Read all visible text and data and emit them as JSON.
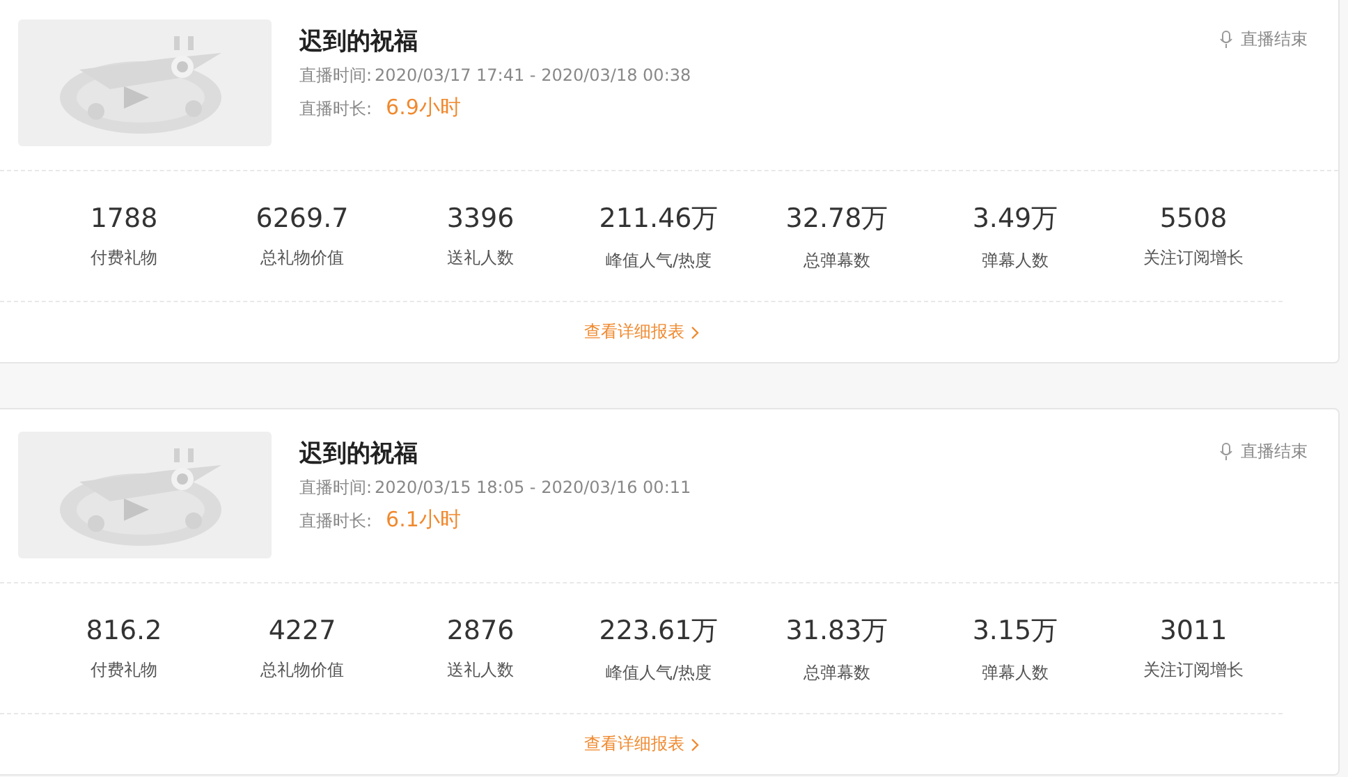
{
  "sessions": [
    {
      "title": "迟到的祝福",
      "time_label": "直播时间:",
      "time_range": "2020/03/17 17:41 - 2020/03/18 00:38",
      "duration_label": "直播时长:",
      "duration": "6.9小时",
      "status": "直播结束",
      "stats": [
        {
          "value": "1788",
          "label": "付费礼物"
        },
        {
          "value": "6269.7",
          "label": "总礼物价值"
        },
        {
          "value": "3396",
          "label": "送礼人数"
        },
        {
          "value": "211.46万",
          "label": "峰值人气/热度"
        },
        {
          "value": "32.78万",
          "label": "总弹幕数"
        },
        {
          "value": "3.49万",
          "label": "弹幕人数"
        },
        {
          "value": "5508",
          "label": "关注订阅增长"
        }
      ],
      "link": "查看详细报表"
    },
    {
      "title": "迟到的祝福",
      "time_label": "直播时间:",
      "time_range": "2020/03/15 18:05 - 2020/03/16 00:11",
      "duration_label": "直播时长:",
      "duration": "6.1小时",
      "status": "直播结束",
      "stats": [
        {
          "value": "816.2",
          "label": "付费礼物"
        },
        {
          "value": "4227",
          "label": "总礼物价值"
        },
        {
          "value": "2876",
          "label": "送礼人数"
        },
        {
          "value": "223.61万",
          "label": "峰值人气/热度"
        },
        {
          "value": "31.83万",
          "label": "总弹幕数"
        },
        {
          "value": "3.15万",
          "label": "弹幕人数"
        },
        {
          "value": "3011",
          "label": "关注订阅增长"
        }
      ],
      "link": "查看详细报表"
    }
  ]
}
